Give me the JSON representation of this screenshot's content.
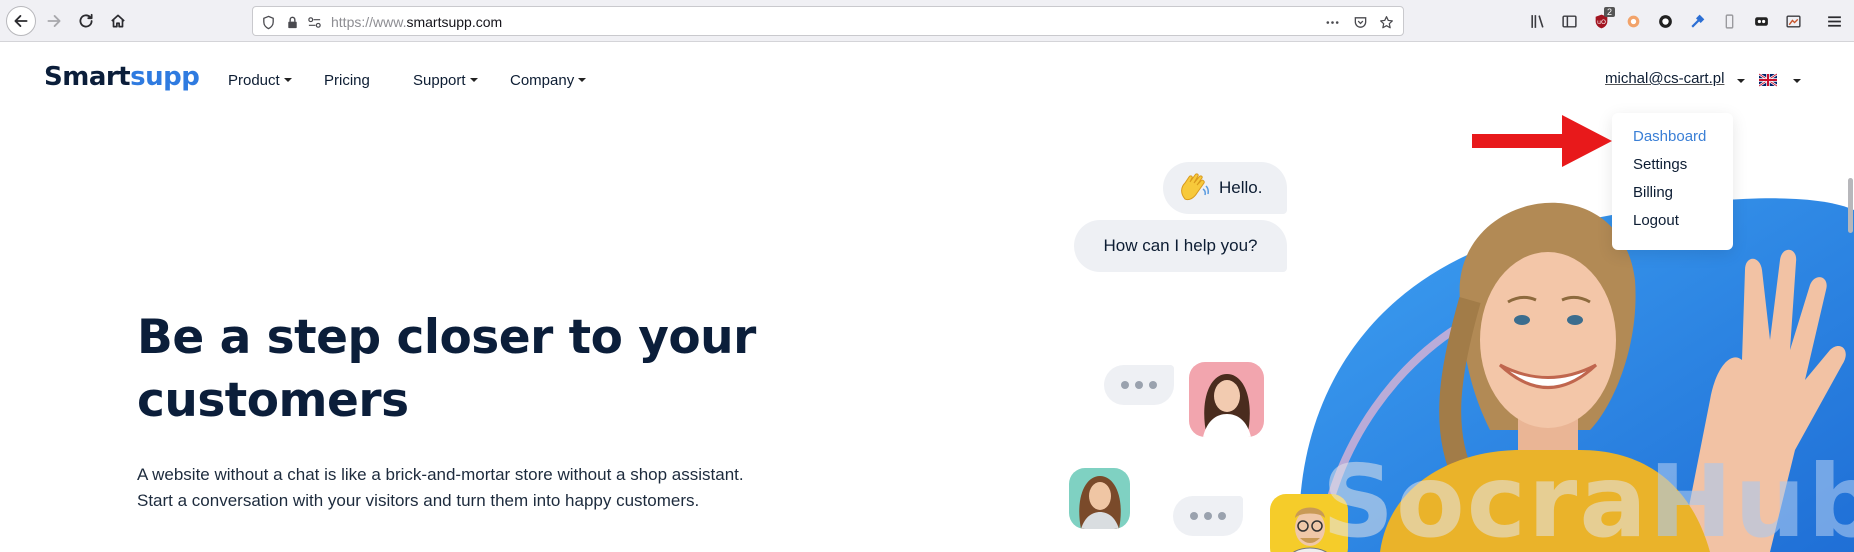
{
  "browser": {
    "url_prefix": "https://www.",
    "url_domain": "smartsupp.com",
    "ublock_badge": "2"
  },
  "nav": {
    "logo_part1": "Smart",
    "logo_part2": "supp",
    "product": "Product",
    "pricing": "Pricing",
    "support": "Support",
    "company": "Company",
    "account_email": "michal@cs-cart.pl"
  },
  "dropdown": {
    "items": [
      {
        "label": "Dashboard",
        "active": true
      },
      {
        "label": "Settings",
        "active": false
      },
      {
        "label": "Billing",
        "active": false
      },
      {
        "label": "Logout",
        "active": false
      }
    ]
  },
  "hero": {
    "title": "Be a step closer to your customers",
    "text": "A website without a chat is like a brick-and-mortar store without a shop assistant. Start a conversation with your visitors and turn them into happy customers."
  },
  "chat": {
    "hello": "Hello.",
    "help": "How can I help you?"
  },
  "watermark": {
    "part1": "Socra",
    "part2": "Hub"
  },
  "colors": {
    "brand_dark": "#0b1e3a",
    "brand_blue": "#2f7be0",
    "active_link": "#3a7fd6",
    "arrow_red": "#e8191b",
    "hero_blue": "#2f8ee8"
  },
  "icons": {
    "back": "back-arrow-icon",
    "forward": "forward-arrow-icon",
    "reload": "reload-icon",
    "home": "home-icon",
    "flag": "uk-flag-icon"
  }
}
